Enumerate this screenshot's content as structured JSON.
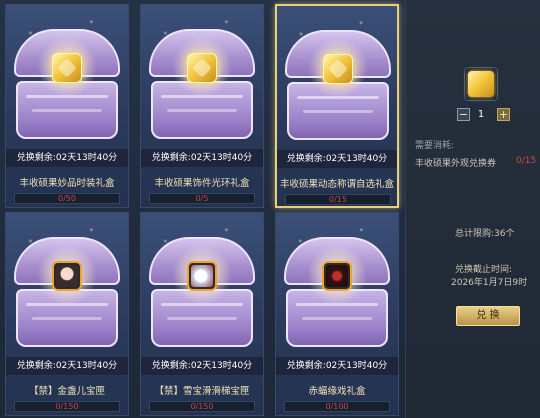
{
  "cards": [
    {
      "timer": "兑换剩余:02天13时40分",
      "name": "丰收硕果妙品时装礼盒",
      "progress": "0/50",
      "progress_fraction": 0,
      "icon": "gold-crate-icon"
    },
    {
      "timer": "兑换剩余:02天13时40分",
      "name": "丰收硕果饰件光环礼盒",
      "progress": "0/5",
      "progress_fraction": 0,
      "icon": "gold-crate-icon"
    },
    {
      "timer": "兑换剩余:02天13时40分",
      "name": "丰收硕果动态称谓自选礼盒",
      "progress": "0/15",
      "progress_fraction": 0,
      "icon": "gold-crate-icon"
    },
    {
      "timer": "兑换剩余:02天13时40分",
      "name": "【禁】金盏儿宝匣",
      "progress": "0/150",
      "progress_fraction": 0,
      "icon": "character-portrait-icon"
    },
    {
      "timer": "兑换剩余:02天13时40分",
      "name": "【禁】雪宝滑滑梯宝匣",
      "progress": "0/150",
      "progress_fraction": 0,
      "icon": "pet-portrait-icon"
    },
    {
      "timer": "兑换剩余:02天13时40分",
      "name": "赤蝠缘戏礼盒",
      "progress": "0/100",
      "progress_fraction": 0,
      "icon": "bat-portrait-icon"
    }
  ],
  "side": {
    "item_icon": "voucher-crate-icon",
    "quantity": "1",
    "minus": "−",
    "plus": "+",
    "cost_label": "需要消耗:",
    "cost_item": "丰收硕果外观兑换券",
    "cost_count": "0/15",
    "total_limit": "总计限购:36个",
    "deadline_label": "兑换截止时间:",
    "deadline_value": "2026年1月7日9时",
    "redeem_button": "兑 换"
  },
  "colors": {
    "selected_border": "#e6d07a",
    "progress_text": "#c04848",
    "cost_count": "#d04a3a",
    "button_gold": "#b8934a"
  }
}
